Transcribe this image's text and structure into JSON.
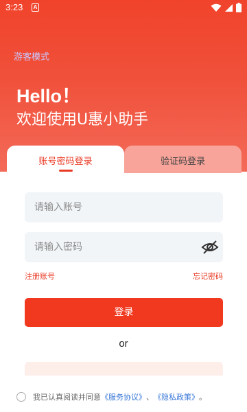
{
  "status_bar": {
    "time": "3:23",
    "notification_glyph": "A"
  },
  "header": {
    "guest_mode": "游客模式",
    "hello": "Hello！",
    "welcome": "欢迎使用U惠小助手"
  },
  "tabs": [
    {
      "label": "账号密码登录",
      "active": true
    },
    {
      "label": "验证码登录",
      "active": false
    }
  ],
  "form": {
    "account_placeholder": "请输入账号",
    "password_placeholder": "请输入密码",
    "register_link": "注册账号",
    "forgot_link": "忘记密码",
    "login_button": "登录",
    "or_text": "or"
  },
  "agreement": {
    "prefix": "我已认真阅读并同意",
    "service_link": "《服务协议》",
    "separator": "、",
    "privacy_link": "《隐私政策》",
    "suffix": "。"
  },
  "colors": {
    "primary": "#f0391f",
    "tab_inactive": "#f9a49a",
    "field_bg": "#f2f5f8",
    "link_blue": "#3a78d8"
  }
}
